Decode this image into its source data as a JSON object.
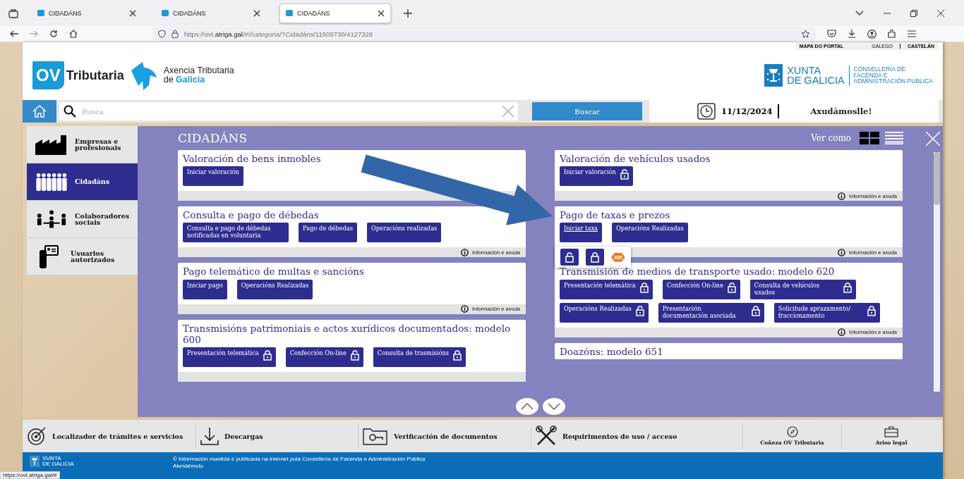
{
  "browser": {
    "tabs": [
      {
        "label": "CIDADÁNS",
        "selected": false
      },
      {
        "label": "CIDADÁNS",
        "selected": false
      },
      {
        "label": "CIDADÁNS",
        "selected": true
      }
    ],
    "url_prefix": "https://ovt.",
    "url_host": "atriga.gal",
    "url_rest": "/#!/categoria/?Cidadáns/11609730/4127328",
    "status_url": "https://ovt.atriga.gal/#"
  },
  "header": {
    "top_links": [
      "MAPA DO PORTAL",
      "GALEGO",
      "CASTELÁN"
    ],
    "logo_badge": "OV",
    "logo_word": "Tributaria",
    "agency_line1": "Axencia Tributaria",
    "agency_line2_prefix": "de",
    "agency_line2_name": "Galicia",
    "xunta_line1": "XUNTA",
    "xunta_line2": "DE GALICIA",
    "department_lines": [
      "CONSELLERÍA DE",
      "FACENDA E",
      "ADMINISTRACIÓN PÚBLICA"
    ]
  },
  "search": {
    "placeholder": "Busca",
    "button": "Buscar",
    "date": "11/12/2024",
    "help": "Axudámoslle!"
  },
  "sidebar": {
    "items": [
      {
        "label": "Empresas e profesionais",
        "kind": "factory",
        "selected": false
      },
      {
        "label": "Cidadáns",
        "kind": "people",
        "selected": true
      },
      {
        "label": "Colaboradores sociais",
        "kind": "meeting",
        "selected": false
      },
      {
        "label": "Usuarios autorizados",
        "kind": "card",
        "selected": false
      }
    ]
  },
  "panel": {
    "title": "CIDADÁNS",
    "view_label": "Ver como",
    "left_cards": [
      {
        "title": "Valoración de bens inmobles",
        "buttons": [
          {
            "label": "Iniciar valoración"
          }
        ]
      },
      {
        "title": "Consulta e pago de débedas",
        "buttons": [
          {
            "label": "Consulta e pago de débedas notificadas en voluntaria"
          },
          {
            "label": "Pago de débedas"
          },
          {
            "label": "Operacións realizadas"
          }
        ],
        "info": "Información e axuda"
      },
      {
        "title": "Pago telemático de multas e sancións",
        "buttons": [
          {
            "label": "Iniciar pago"
          },
          {
            "label": "Operacións Realizadas"
          }
        ],
        "info": "Información e axuda"
      },
      {
        "title": "Transmisións patrimoniais e actos xurídicos documentados: modelo 600",
        "buttons": [
          {
            "label": "Presentación telemática",
            "kind": "locked"
          },
          {
            "label": "Confección On-line",
            "kind": "unlocked"
          },
          {
            "label": "Consulta de trasmisións",
            "kind": "locked"
          }
        ]
      }
    ],
    "right_cards": [
      {
        "title": "Valoración de vehículos usados",
        "buttons": [
          {
            "label": "Iniciar valoración",
            "kind": "unlocked"
          }
        ],
        "info": "Información e axuda"
      },
      {
        "title": "Pago de taxas e prezos",
        "buttons": [
          {
            "label": "Iniciar taxa",
            "hovered": true
          },
          {
            "label": "Operacións Realizadas",
            "hovered": false
          }
        ],
        "info": "Información e axuda",
        "popup": [
          {
            "kind": "unlocked"
          },
          {
            "kind": "locked"
          },
          {
            "kind": "badge",
            "label": "365"
          }
        ]
      },
      {
        "title": "Transmisión de medios de transporte usado: modelo 620",
        "buttons": [
          {
            "label": "Presentación telemática",
            "kind": "locked"
          },
          {
            "label": "Confección On-line",
            "kind": "unlocked"
          },
          {
            "label": "Consulta de vehículos usados",
            "kind": "locked"
          },
          {
            "label": "Operacións Realizadas",
            "kind": "unlocked"
          },
          {
            "label": "Presentación documentación asociada",
            "kind": "locked"
          },
          {
            "label": "Solicitude aprazamento/ fraccionamento",
            "kind": "locked"
          }
        ],
        "info": "Información e axuda"
      },
      {
        "title": "Doazóns: modelo 651"
      }
    ]
  },
  "footer": {
    "links": [
      {
        "label": "Localizador de trámites e servicios",
        "kind": "target"
      },
      {
        "label": "Descargas",
        "kind": "download"
      },
      {
        "label": "Verificación de documentos",
        "kind": "folder"
      },
      {
        "label": "Requirimentos de uso / acceso",
        "kind": "tools"
      },
      {
        "label": "Coñeza OV Tributaria",
        "kind": "compass"
      },
      {
        "label": "Aviso legal",
        "kind": "briefcase"
      }
    ],
    "xunta_line1": "XUNTA",
    "xunta_line2": "DE GALICIA",
    "notice": "© Información mantida e publicada na internet pola Consellería de Facenda e Administración Pública",
    "contact": "Atendémolo"
  }
}
